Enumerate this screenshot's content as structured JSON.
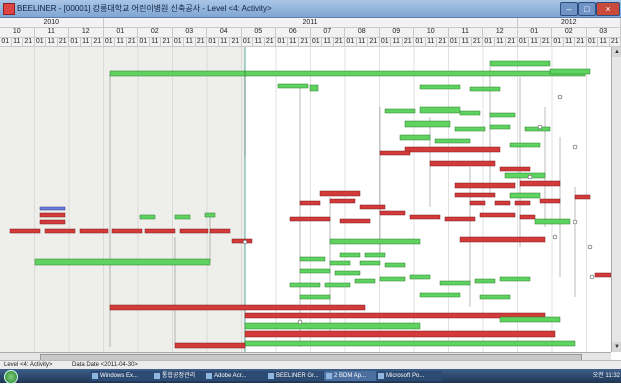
{
  "window": {
    "title": "BEELINER - [00001] 강릉대학교 어린이병원 신축공사 - Level <4: Activity>"
  },
  "timescale": {
    "years": [
      "2010",
      "2011",
      "2012"
    ],
    "months": [
      "10",
      "11",
      "12",
      "01",
      "02",
      "03",
      "04",
      "05",
      "06",
      "07",
      "08",
      "09",
      "10",
      "11",
      "12",
      "01",
      "02",
      "03"
    ],
    "days": [
      "01",
      "11",
      "21"
    ]
  },
  "status": {
    "level": "Level <4: Activity>",
    "data_date": "Data Date <2011-04-30>"
  },
  "taskbar": {
    "items": [
      "Windows Ex...",
      "통합공정관리",
      "Adobe Acr...",
      "BEELINER Gr...",
      "2 BDM Ap...",
      "Microsoft Po..."
    ],
    "clock": "오전 11:32"
  },
  "colors": {
    "critical": "#d33a3a",
    "normal": "#5fd35f",
    "selection_band": "#eeeeea",
    "blue_activity": "#6a7cd8"
  }
}
